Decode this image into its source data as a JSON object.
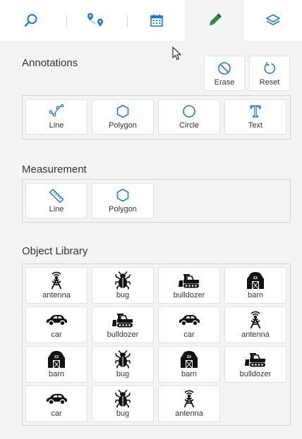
{
  "tabs": [
    {
      "icon": "search-icon",
      "active": false
    },
    {
      "icon": "route-icon",
      "active": false
    },
    {
      "icon": "calendar-icon",
      "active": false
    },
    {
      "icon": "pencil-icon",
      "active": true
    },
    {
      "icon": "layers-icon",
      "active": false
    }
  ],
  "annotations": {
    "title": "Annotations",
    "erase_label": "Erase",
    "reset_label": "Reset",
    "tools": [
      {
        "label": "Line",
        "icon": "polyline-icon"
      },
      {
        "label": "Polygon",
        "icon": "hexagon-icon"
      },
      {
        "label": "Circle",
        "icon": "circle-icon"
      },
      {
        "label": "Text",
        "icon": "text-icon"
      }
    ]
  },
  "measurement": {
    "title": "Measurement",
    "tools": [
      {
        "label": "Line",
        "icon": "ruler-icon"
      },
      {
        "label": "Polygon",
        "icon": "hexagon-icon"
      }
    ]
  },
  "object_library": {
    "title": "Object Library",
    "items": [
      {
        "label": "antenna",
        "icon": "antenna-icon"
      },
      {
        "label": "bug",
        "icon": "bug-icon"
      },
      {
        "label": "bulldozer",
        "icon": "bulldozer-icon"
      },
      {
        "label": "barn",
        "icon": "barn-icon"
      },
      {
        "label": "car",
        "icon": "car-icon"
      },
      {
        "label": "bulldozer",
        "icon": "bulldozer-icon"
      },
      {
        "label": "car",
        "icon": "car-icon"
      },
      {
        "label": "antenna",
        "icon": "antenna-icon"
      },
      {
        "label": "barn",
        "icon": "barn-icon"
      },
      {
        "label": "bug",
        "icon": "bug-icon"
      },
      {
        "label": "barn",
        "icon": "barn-icon"
      },
      {
        "label": "bulldozer",
        "icon": "bulldozer-icon"
      },
      {
        "label": "car",
        "icon": "car-icon"
      },
      {
        "label": "bug",
        "icon": "bug-icon"
      },
      {
        "label": "antenna",
        "icon": "antenna-icon"
      }
    ]
  },
  "colors": {
    "accent_blue": "#1e7bd6",
    "pencil_green": "#2e8b3d",
    "panel_bg": "#f4f4f4"
  }
}
